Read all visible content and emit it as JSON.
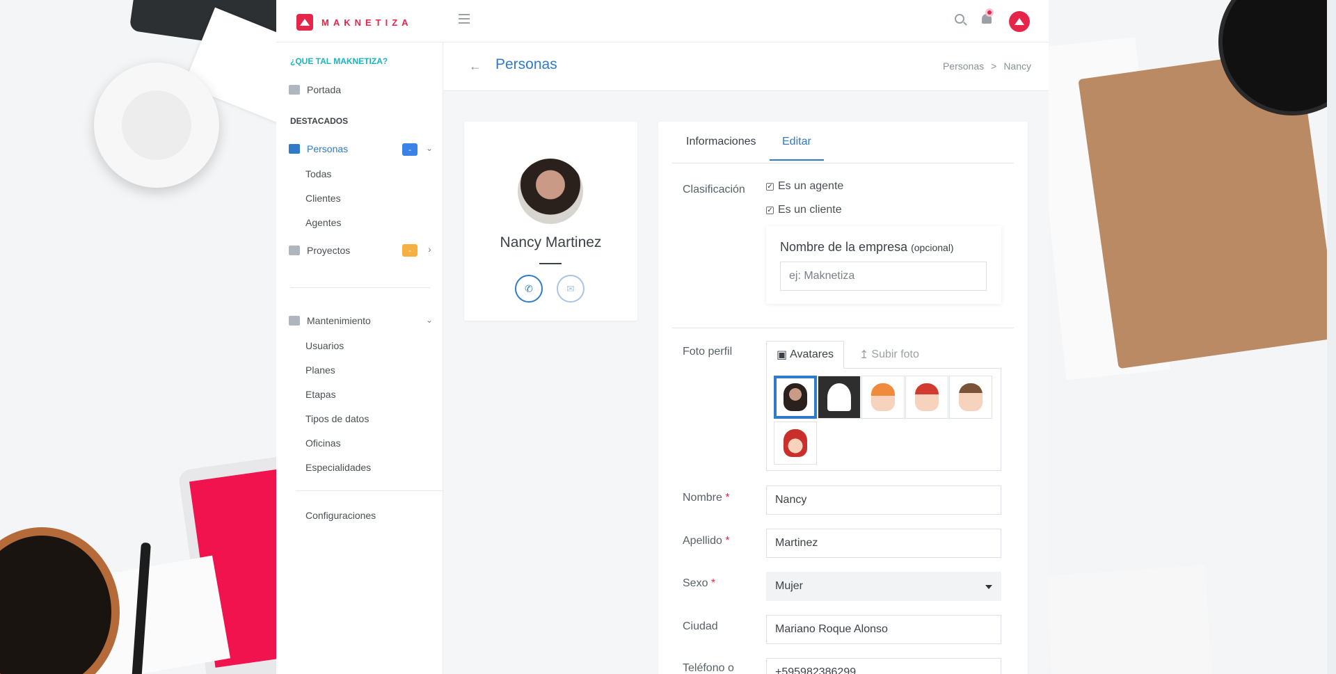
{
  "topbar": {
    "logo_text": "MAKNETIZA",
    "brand_color": "#e5254a"
  },
  "sidebar": {
    "section_que_tal": "¿QUE TAL MAKNETIZA?",
    "portada": "Portada",
    "section_destacados": "DESTACADOS",
    "personas": "Personas",
    "personas_badge": "-",
    "personas_sub": [
      "Todas",
      "Clientes",
      "Agentes"
    ],
    "proyectos": "Proyectos",
    "proyectos_badge": "-",
    "mantenimiento": "Mantenimiento",
    "mantenimiento_sub": [
      "Usuarios",
      "Planes",
      "Etapas",
      "Tipos de datos",
      "Oficinas",
      "Especialidades"
    ],
    "configuraciones": "Configuraciones"
  },
  "page": {
    "title": "Personas",
    "breadcrumb": [
      "Personas",
      ">",
      "Nancy"
    ]
  },
  "profile": {
    "name": "Nancy Martinez",
    "whatsapp_icon": "whatsapp-icon",
    "email_icon": "envelope-icon"
  },
  "form": {
    "tabs": [
      "Informaciones",
      "Editar"
    ],
    "active_tab": "Editar",
    "clasificacion_label": "Clasificación",
    "es_agente": "Es un agente",
    "es_cliente": "Es un cliente",
    "empresa_label": "Nombre de la empresa",
    "empresa_optional": "(opcional)",
    "empresa_placeholder": "ej: Maknetiza",
    "foto_label": "Foto perfil",
    "avatares_tab": "Avatares",
    "subir_tab": "Subir foto",
    "nombre_label": "Nombre",
    "nombre_value": "Nancy",
    "apellido_label": "Apellido",
    "apellido_value": "Martinez",
    "sexo_label": "Sexo",
    "sexo_value": "Mujer",
    "ciudad_label": "Ciudad",
    "ciudad_value": "Mariano Roque Alonso",
    "telefono_label": "Teléfono o",
    "telefono_value": "+595982386299",
    "required_mark": "*"
  },
  "colors": {
    "accent_blue": "#2f7ac9",
    "badge_blue": "#3b82e6",
    "badge_orange": "#f5b041",
    "teal": "#19b5c0"
  }
}
